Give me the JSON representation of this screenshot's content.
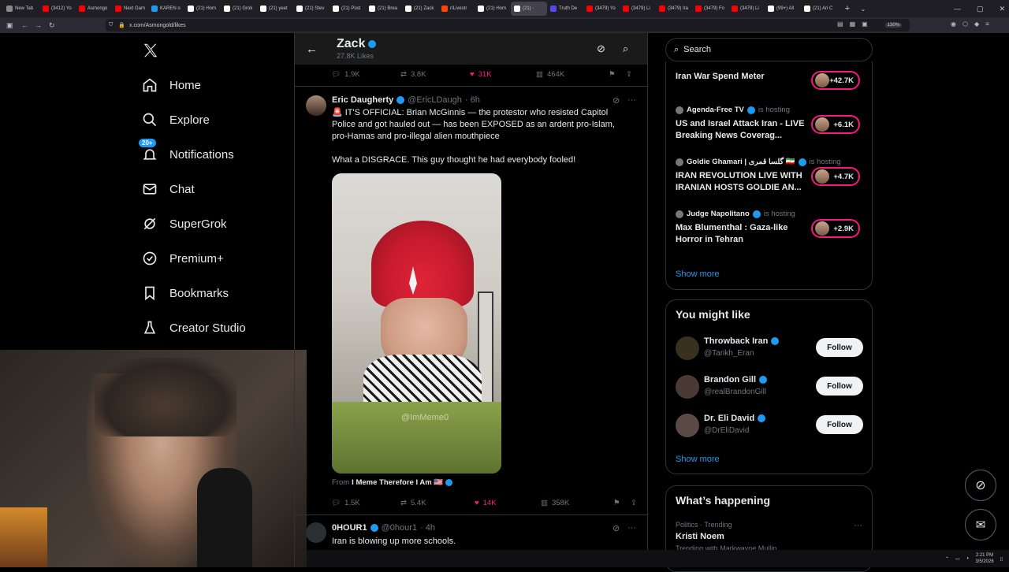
{
  "browser": {
    "tabs": [
      {
        "label": "New Tab",
        "color": "#8a8a8a",
        "active": false
      },
      {
        "label": "(3412) Yo",
        "color": "#ff0000",
        "active": false
      },
      {
        "label": "Asmongo",
        "color": "#ff0000",
        "active": false
      },
      {
        "label": "Next Gam",
        "color": "#ff0000",
        "active": false
      },
      {
        "label": "KAREN o",
        "color": "#1d9bf0",
        "active": false
      },
      {
        "label": "(21) Hom",
        "color": "#ffffff",
        "active": false
      },
      {
        "label": "(21) Grok",
        "color": "#ffffff",
        "active": false
      },
      {
        "label": "(21) yeet",
        "color": "#ffffff",
        "active": false
      },
      {
        "label": "(21) Stev",
        "color": "#ffffff",
        "active": false
      },
      {
        "label": "(21) Post",
        "color": "#ffffff",
        "active": false
      },
      {
        "label": "(21) Brea",
        "color": "#ffffff",
        "active": false
      },
      {
        "label": "(21) Zack",
        "color": "#ffffff",
        "active": false
      },
      {
        "label": "r/Livestr",
        "color": "#ff4500",
        "active": false
      },
      {
        "label": "(21) Hom",
        "color": "#ffffff",
        "active": false
      },
      {
        "label": "(21) ·",
        "color": "#ffffff",
        "active": true
      },
      {
        "label": "Truth De",
        "color": "#5448ee",
        "active": false
      },
      {
        "label": "(3479) Yo",
        "color": "#ff0000",
        "active": false
      },
      {
        "label": "(3479) Li",
        "color": "#ff0000",
        "active": false
      },
      {
        "label": "(3479) Ira",
        "color": "#ff0000",
        "active": false
      },
      {
        "label": "(3479) Fo",
        "color": "#ff0000",
        "active": false
      },
      {
        "label": "(3479) Li",
        "color": "#ff0000",
        "active": false
      },
      {
        "label": "(99+) All",
        "color": "#ffffff",
        "active": false
      },
      {
        "label": "(21) Ari C",
        "color": "#ffffff",
        "active": false
      }
    ],
    "url": "x.com/Asmongold/likes",
    "zoom": "130%"
  },
  "sidebar": {
    "items": [
      {
        "label": "Home",
        "icon": "home-icon"
      },
      {
        "label": "Explore",
        "icon": "search-icon"
      },
      {
        "label": "Notifications",
        "icon": "bell-icon",
        "badge": "20+"
      },
      {
        "label": "Chat",
        "icon": "mail-icon"
      },
      {
        "label": "SuperGrok",
        "icon": "grok-icon"
      },
      {
        "label": "Premium+",
        "icon": "verified-badge-icon"
      },
      {
        "label": "Bookmarks",
        "icon": "bookmark-icon"
      },
      {
        "label": "Creator Studio",
        "icon": "flask-icon"
      }
    ]
  },
  "profile_header": {
    "name": "Zack",
    "subtitle": "27.8K Likes"
  },
  "prev_post_stats": {
    "replies": "1.9K",
    "reposts": "3.8K",
    "likes": "31K",
    "views": "464K"
  },
  "post": {
    "author": "Eric Daugherty",
    "handle": "@EricLDaugh",
    "time": "· 6h",
    "text1": "🚨 IT'S OFFICIAL: Brian McGinnis — the protestor who resisted Capitol Police and got hauled out — has been EXPOSED as an ardent pro-Islam, pro-Hamas and pro-illegal alien mouthpiece",
    "text2": "What a DISGRACE. This guy thought he had everybody fooled!",
    "watermark": "@ImMeme0",
    "from_prefix": "From",
    "from_name": "I Meme Therefore I Am 🇺🇸",
    "stats": {
      "replies": "1.5K",
      "reposts": "5.4K",
      "likes": "14K",
      "views": "358K"
    }
  },
  "next_post": {
    "author": "0HOUR1",
    "handle": "@0hour1",
    "time": "· 4h",
    "text": "Iran is blowing up more schools."
  },
  "search": {
    "placeholder": "Search"
  },
  "live": {
    "items": [
      {
        "title": "Iran War Spend Meter",
        "count": "+42.7K"
      },
      {
        "host": "Agenda-Free TV",
        "status": "is hosting",
        "title": "US and Israel Attack Iran - LIVE Breaking News Coverag...",
        "count": "+6.1K"
      },
      {
        "host": "Goldie Ghamari | گلسا قمری 🇮🇷",
        "status": "is hosting",
        "title": "IRAN REVOLUTION LIVE WITH IRANIAN HOSTS GOLDIE AN...",
        "count": "+4.7K"
      },
      {
        "host": "Judge Napolitano",
        "status": "is hosting",
        "title": "Max Blumenthal : Gaza-like Horror in Tehran",
        "count": "+2.9K"
      }
    ],
    "show_more": "Show more"
  },
  "who_to_follow": {
    "title": "You might like",
    "users": [
      {
        "name": "Throwback Iran",
        "handle": "@Tarikh_Eran",
        "button": "Follow"
      },
      {
        "name": "Brandon Gill",
        "handle": "@realBrandonGill",
        "button": "Follow"
      },
      {
        "name": "Dr. Eli David",
        "handle": "@DrEliDavid",
        "button": "Follow"
      }
    ],
    "show_more": "Show more"
  },
  "happening": {
    "title": "What’s happening",
    "category": "Politics · Trending",
    "topic": "Kristi Noem",
    "sub": "Trending with Markwayne Mullin"
  },
  "taskbar": {
    "time": "2:21 PM",
    "date": "3/5/2026"
  },
  "colors": {
    "accent": "#1d9bf0",
    "like": "#f91880",
    "bg": "#000000",
    "border": "#2f3336"
  }
}
